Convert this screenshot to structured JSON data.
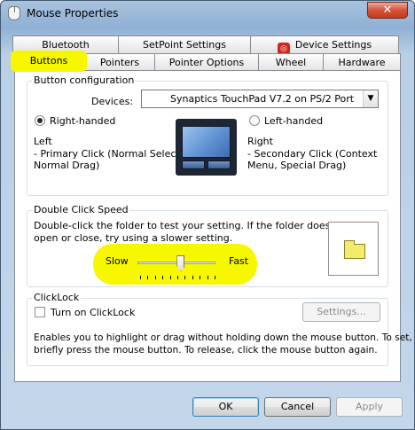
{
  "window": {
    "title": "Mouse Properties",
    "close_glyph": "✕"
  },
  "tabs": {
    "row1": [
      {
        "label": "Bluetooth"
      },
      {
        "label": "SetPoint Settings"
      },
      {
        "label": "Device Settings"
      }
    ],
    "row2": [
      {
        "label": "Buttons"
      },
      {
        "label": "Pointers"
      },
      {
        "label": "Pointer Options"
      },
      {
        "label": "Wheel"
      },
      {
        "label": "Hardware"
      }
    ]
  },
  "button_config": {
    "group_title": "Button configuration",
    "devices_label": "Devices:",
    "device_value": "Synaptics TouchPad V7.2 on PS/2 Port",
    "right_handed_label": "Right-handed",
    "left_handed_label": "Left-handed",
    "right_handed_selected": true,
    "left_title": "Left",
    "left_desc_1": "- Primary Click (Normal Select,",
    "left_desc_2": "Normal Drag)",
    "right_title": "Right",
    "right_desc_1": "- Secondary Click (Context",
    "right_desc_2": "Menu, Special Drag)"
  },
  "double_click": {
    "group_title": "Double Click Speed",
    "desc_1": "Double-click the folder to test your setting.  If the folder does not",
    "desc_2": "open or close, try using a slower setting.",
    "slow_label": "Slow",
    "fast_label": "Fast",
    "speed_fraction": 0.55
  },
  "clicklock": {
    "group_title": "ClickLock",
    "checkbox_label": "Turn on ClickLock",
    "checked": false,
    "settings_button": "Settings...",
    "desc_1": "Enables you to highlight or drag without holding down the mouse button.  To set,",
    "desc_2": "briefly press the mouse button.  To release, click the mouse button again."
  },
  "footer": {
    "ok": "OK",
    "cancel": "Cancel",
    "apply": "Apply"
  },
  "colors": {
    "highlight": "#f7f700",
    "close_button": "#d4533b"
  }
}
